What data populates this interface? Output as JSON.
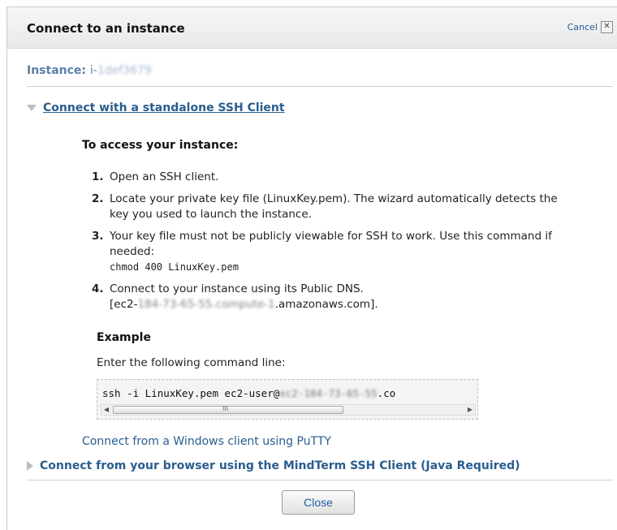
{
  "dialog": {
    "title": "Connect to an instance",
    "cancel_label": "Cancel",
    "close_glyph": "✕"
  },
  "instance": {
    "label": "Instance:",
    "id_prefix": "i-",
    "id_obscured": "1def3679"
  },
  "ssh_section": {
    "label": "Connect with a standalone SSH Client",
    "expanded": true,
    "access_heading": "To access your instance:",
    "steps": [
      {
        "num": "1.",
        "text": "Open an SSH client."
      },
      {
        "num": "2.",
        "text": "Locate your private key file (LinuxKey.pem). The wizard automatically detects the key you used to launch the instance."
      },
      {
        "num": "3.",
        "text": "Your key file must not be publicly viewable for SSH to work. Use this command if needed:",
        "code": "chmod 400 LinuxKey.pem"
      },
      {
        "num": "4.",
        "text": "Connect to your instance using its Public DNS.",
        "dns_prefix": "[ec2-",
        "dns_obscured": "184-73-65-55.compute-1",
        "dns_suffix": ".amazonaws.com]."
      }
    ],
    "example_heading": "Example",
    "example_desc": "Enter the following command line:",
    "command_visible": "ssh -i LinuxKey.pem ec2-user@",
    "command_obscured": "ec2-184-73-65-55",
    "command_tail": ".co",
    "putty_link": "Connect from a Windows client using PuTTY"
  },
  "mindterm_section": {
    "label": "Connect from your browser using the MindTerm SSH Client (Java Required)",
    "expanded": false
  },
  "footer": {
    "close_label": "Close"
  },
  "icons": {
    "expanded": "triangle-down-icon",
    "collapsed": "triangle-right-icon",
    "close": "close-x-icon"
  },
  "colors": {
    "link": "#2a5d8f",
    "instance": "#5b7fa8",
    "header_bg": "#efefef"
  }
}
